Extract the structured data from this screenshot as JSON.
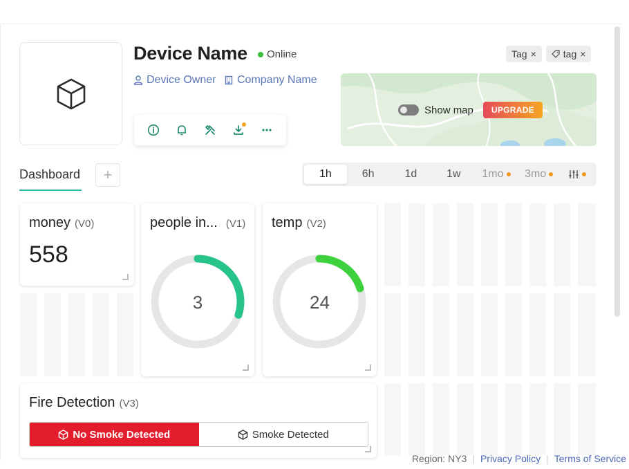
{
  "device": {
    "name": "Device Name",
    "status": "Online",
    "owner": "Device Owner",
    "company": "Company Name"
  },
  "actions": [
    {
      "icon": "info-icon"
    },
    {
      "icon": "bell-icon"
    },
    {
      "icon": "tools-icon"
    },
    {
      "icon": "download-icon",
      "notification": true
    },
    {
      "icon": "more-icon"
    }
  ],
  "tags": [
    {
      "label": "Tag"
    },
    {
      "label": "tag"
    }
  ],
  "map": {
    "show_map_label": "Show map",
    "upgrade_label": "UPGRADE"
  },
  "tabs": {
    "dashboard": "Dashboard",
    "add": "+"
  },
  "time_ranges": [
    {
      "label": "1h",
      "selected": true
    },
    {
      "label": "6h"
    },
    {
      "label": "1d"
    },
    {
      "label": "1w"
    },
    {
      "label": "1mo",
      "premium": true
    },
    {
      "label": "3mo",
      "premium": true
    }
  ],
  "widgets": {
    "money": {
      "title": "money",
      "pin": "(V0)",
      "value": "558"
    },
    "people": {
      "title": "people in...",
      "pin": "(V1)",
      "value": "3",
      "fraction": 0.3
    },
    "temp": {
      "title": "temp",
      "pin": "(V2)",
      "value": "24",
      "fraction": 0.2
    },
    "fire": {
      "title": "Fire Detection",
      "pin": "(V3)",
      "option_on": "No Smoke Detected",
      "option_off": "Smoke Detected"
    }
  },
  "footer": {
    "region": "Region: NY3",
    "privacy": "Privacy Policy",
    "terms": "Terms of Service"
  },
  "colors": {
    "accent": "#26b7a0",
    "people_gauge": "#26c48a",
    "temp_gauge": "#3dd13d",
    "alert": "#e41d2d",
    "link": "#4a67b8"
  }
}
